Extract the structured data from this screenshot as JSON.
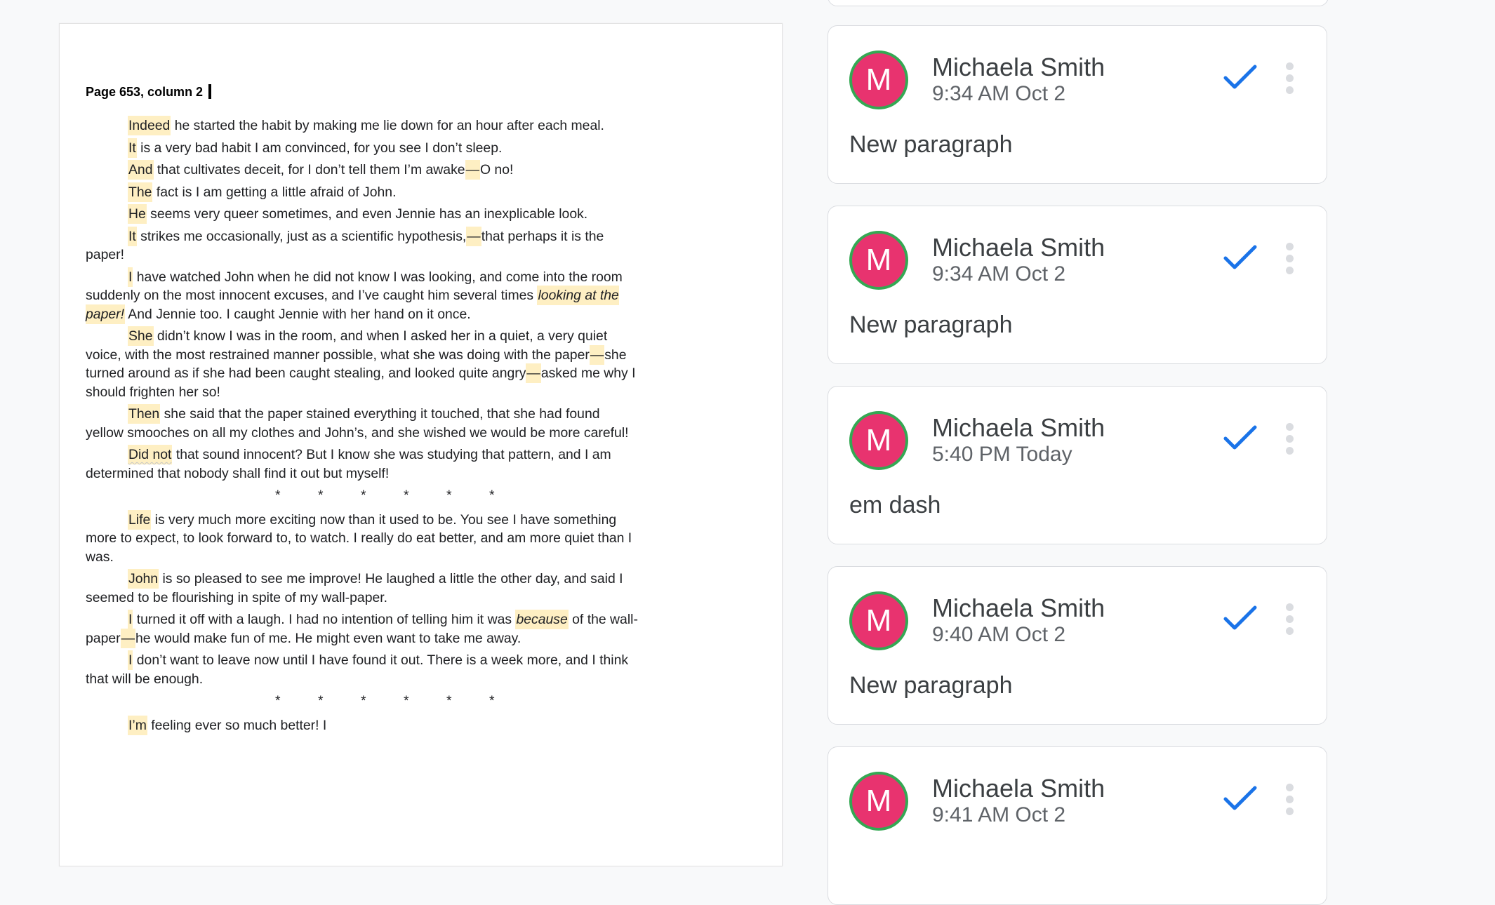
{
  "document": {
    "header": "Page 653, column 2",
    "paragraphs": [
      [
        {
          "t": "Indeed",
          "h": true
        },
        {
          "t": " he started the habit by making me lie down for an hour after each meal."
        }
      ],
      [
        {
          "t": "It",
          "h": true
        },
        {
          "t": " is a very bad habit I am convinced, for you see I don’t sleep."
        }
      ],
      [
        {
          "t": "And",
          "h": true
        },
        {
          "t": " that cultivates deceit, for I don’t tell them I’m awake"
        },
        {
          "t": "—",
          "h": true
        },
        {
          "t": "O no!"
        }
      ],
      [
        {
          "t": "The",
          "h": true
        },
        {
          "t": " fact is I am getting a little afraid of John."
        }
      ],
      [
        {
          "t": "He",
          "h": true
        },
        {
          "t": " seems very queer sometimes, and even Jennie has an inexplicable look."
        }
      ],
      [
        {
          "t": "It",
          "h": true
        },
        {
          "t": " strikes me occasionally, just as a scientific hypothesis,"
        },
        {
          "t": "—",
          "h": true
        },
        {
          "t": "that perhaps it is the paper!"
        }
      ],
      [
        {
          "t": "I",
          "h": true
        },
        {
          "t": " have watched John when he did not know I was looking, and come into the room suddenly on the most innocent excuses, and I’ve caught him several times "
        },
        {
          "t": "looking at the paper!",
          "h": true,
          "i": true
        },
        {
          "t": " And Jennie too. I caught Jennie with her hand on it once."
        }
      ],
      [
        {
          "t": "She",
          "h": true
        },
        {
          "t": " didn’t know I was in the room, and when I asked her in a quiet, a very quiet voice, with the most restrained manner possible, what she was doing with the paper"
        },
        {
          "t": "—",
          "h": true
        },
        {
          "t": "she turned around as if she had been caught stealing, and looked quite angry"
        },
        {
          "t": "—",
          "h": true
        },
        {
          "t": "asked me why I should frighten her so!"
        }
      ],
      [
        {
          "t": "Then",
          "h": true
        },
        {
          "t": " she said that the paper stained everything it touched, that she had found yellow smooches on all my clothes and John’s, and she wished we would be more careful!"
        }
      ],
      [
        {
          "t": "Did not",
          "h": true,
          "u": true
        },
        {
          "t": " that sound innocent? But I know she was studying that pattern, and I am determined that nobody shall find it out but myself!"
        }
      ],
      "STARS",
      [
        {
          "t": "Life",
          "h": true
        },
        {
          "t": " is very much more exciting now than it used to be. You see I have something more to expect, to look forward to, to watch. I really do eat better, and am more quiet than I was."
        }
      ],
      [
        {
          "t": "John",
          "h": true
        },
        {
          "t": " is so pleased to see me improve! He laughed a little the other day, and said I seemed to be flourishing in spite of my wall-paper."
        }
      ],
      [
        {
          "t": "I",
          "h": true
        },
        {
          "t": " turned it off with a laugh. I had no intention of telling him it was "
        },
        {
          "t": "because",
          "h": true,
          "i": true
        },
        {
          "t": " of the wall-paper"
        },
        {
          "t": "—",
          "h": true
        },
        {
          "t": "he would make fun of me. He might even want to take me away."
        }
      ],
      [
        {
          "t": "I",
          "h": true
        },
        {
          "t": " don’t want to leave now until I have found it out. There is a week more, and I think that will be enough."
        }
      ],
      "STARS",
      [
        {
          "t": "I’m",
          "h": true
        },
        {
          "t": " feeling ever so much better! I"
        }
      ]
    ],
    "stars": [
      "*",
      "*",
      "*",
      "*",
      "*",
      "*"
    ]
  },
  "comments": [
    {
      "avatar": "M",
      "name": "Michaela Smith",
      "time": "9:34 AM Oct 2",
      "text": "New paragraph"
    },
    {
      "avatar": "M",
      "name": "Michaela Smith",
      "time": "9:34 AM Oct 2",
      "text": "New paragraph"
    },
    {
      "avatar": "M",
      "name": "Michaela Smith",
      "time": "5:40 PM Today",
      "text": "em dash"
    },
    {
      "avatar": "M",
      "name": "Michaela Smith",
      "time": "9:40 AM Oct 2",
      "text": "New paragraph"
    },
    {
      "avatar": "M",
      "name": "Michaela Smith",
      "time": "9:41 AM Oct 2",
      "text": ""
    }
  ],
  "icons": {
    "resolve": "check-icon",
    "more": "more-vert-icon"
  },
  "colors": {
    "highlight": "#feefc3",
    "avatar": "#e8336f",
    "avatar_ring": "#34a853",
    "check": "#1a73e8"
  }
}
